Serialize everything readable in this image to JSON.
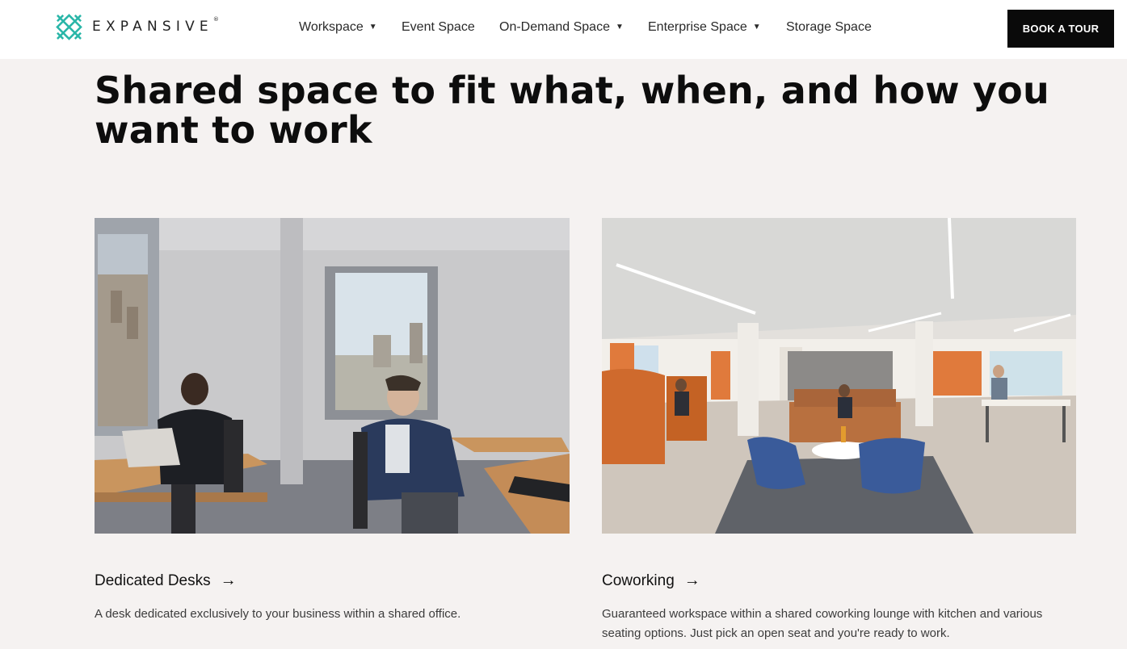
{
  "brand": {
    "name": "EXPANSIVE",
    "registered_mark": "®",
    "accent_color": "#29b6a8"
  },
  "nav": {
    "items": [
      {
        "label": "Workspace",
        "has_dropdown": true
      },
      {
        "label": "Event Space",
        "has_dropdown": false
      },
      {
        "label": "On-Demand Space",
        "has_dropdown": true
      },
      {
        "label": "Enterprise Space",
        "has_dropdown": true
      },
      {
        "label": "Storage Space",
        "has_dropdown": false
      }
    ],
    "cta_label": "BOOK A TOUR"
  },
  "hero": {
    "headline": "Shared space to fit what, when, and how you want to work"
  },
  "cards": [
    {
      "title": "Dedicated Desks",
      "arrow": "→",
      "description": "A desk dedicated exclusively to your business within a shared office."
    },
    {
      "title": "Coworking",
      "arrow": "→",
      "description": "Guaranteed workspace within a shared coworking lounge with kitchen and various seating options. Just pick an open seat and you're ready to work."
    }
  ]
}
